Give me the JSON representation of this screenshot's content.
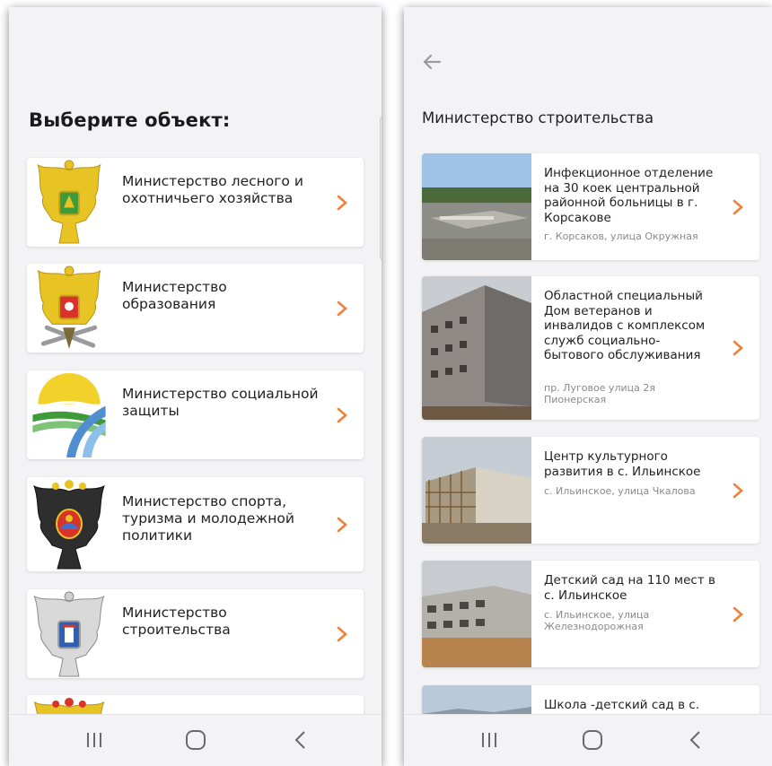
{
  "left_screen": {
    "title": "Выберите объект:",
    "items": [
      {
        "label": "Министерство лесного и охотничьего хозяйства",
        "icon": "forestry-emblem-icon"
      },
      {
        "label": "Министерство образования",
        "icon": "education-emblem-icon"
      },
      {
        "label": "Министерство социальной защиты",
        "icon": "social-protection-logo-icon"
      },
      {
        "label": "Министерство спорта, туризма и молодежной политики",
        "icon": "sport-emblem-icon"
      },
      {
        "label": "Министерство строительства",
        "icon": "construction-emblem-icon"
      },
      {
        "label": "",
        "icon": "emblem-icon"
      }
    ]
  },
  "right_screen": {
    "title": "Министерство строительства",
    "objects": [
      {
        "name": "Инфекционное отделение на 30 коек центральной районной больницы в г. Корсакове",
        "address": "г. Корсаков, улица Окружная"
      },
      {
        "name": "Областной специальный Дом ветеранов и инвалидов с комплексом служб социально-бытового обслуживания",
        "address": "пр. Луговое улица 2я Пионерская"
      },
      {
        "name": "Центр культурного развития в с. Ильинское",
        "address": "с. Ильинское, улица Чкалова"
      },
      {
        "name": "Детский сад на 110 мест в с. Ильинское",
        "address": "с. Ильинское, улица Железнодорожная"
      },
      {
        "name": "Школа -детский сад в с.",
        "address": ""
      }
    ]
  },
  "nav": {
    "recents": "recents-icon",
    "home": "home-icon",
    "back": "back-icon"
  },
  "colors": {
    "accent": "#f0813a",
    "background": "#f3f3f5",
    "card": "#ffffff"
  }
}
